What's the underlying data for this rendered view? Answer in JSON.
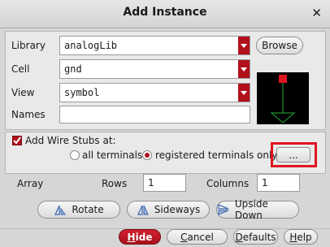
{
  "window": {
    "title": "Add Instance"
  },
  "form": {
    "library": {
      "label": "Library",
      "value": "analogLib"
    },
    "cell": {
      "label": "Cell",
      "value": "gnd"
    },
    "view": {
      "label": "View",
      "value": "symbol"
    },
    "names": {
      "label": "Names",
      "value": ""
    },
    "browse_label": "Browse"
  },
  "stubs": {
    "label": "Add Wire Stubs at:",
    "checked": true,
    "options": [
      {
        "label": "all terminals",
        "selected": false
      },
      {
        "label": "registered terminals only",
        "selected": true
      }
    ],
    "more_label": "..."
  },
  "array": {
    "label": "Array",
    "rows_label": "Rows",
    "rows_value": "1",
    "columns_label": "Columns",
    "columns_value": "1"
  },
  "transforms": {
    "rotate": "Rotate",
    "sideways": "Sideways",
    "upside_down": "Upside Down"
  },
  "footer": {
    "hide": {
      "underlined": "H",
      "rest": "ide"
    },
    "cancel": {
      "underlined": "C",
      "rest": "ancel"
    },
    "defaults": {
      "underlined": "D",
      "rest": "efaults"
    },
    "help": {
      "underlined": "H",
      "rest": "elp"
    }
  },
  "colors": {
    "accent": "#b0101a",
    "highlight": "#e0141e",
    "symbol": "#1fae3a"
  }
}
